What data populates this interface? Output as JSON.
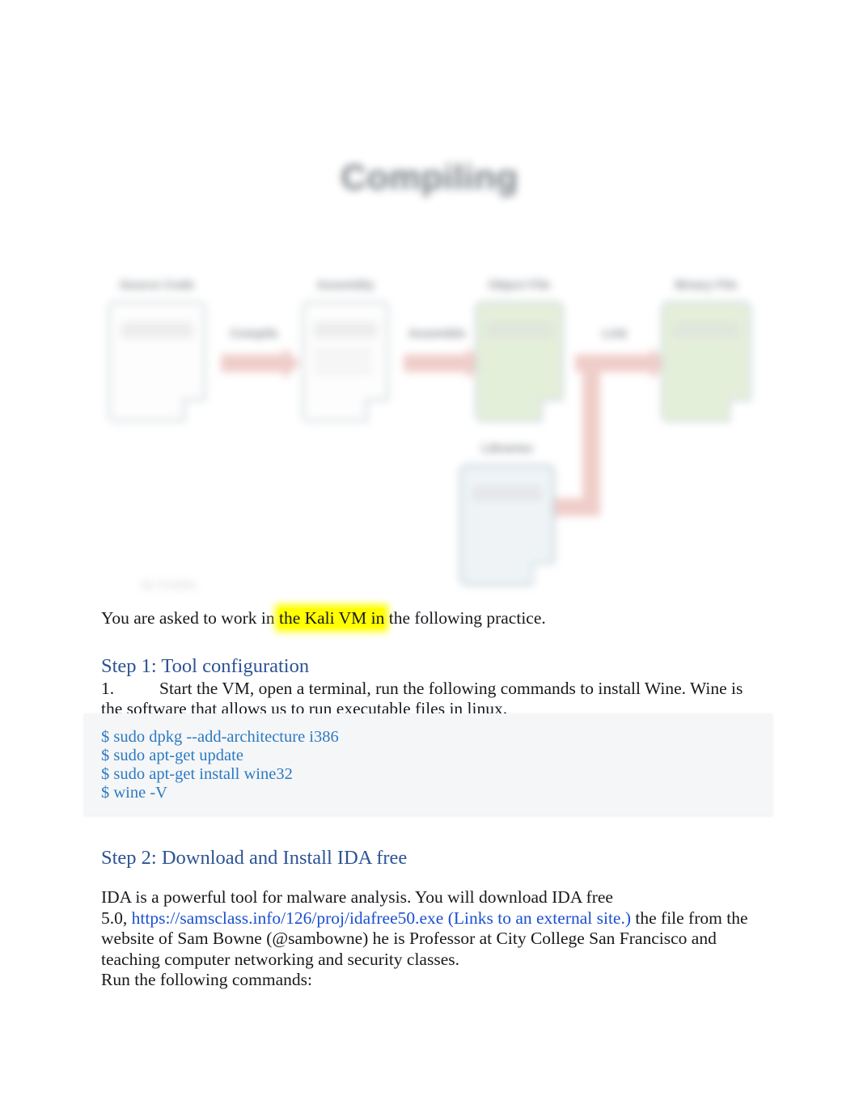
{
  "figure": {
    "title": "Compiling",
    "nodes": [
      {
        "caption": "Source Code",
        "kind": "plain"
      },
      {
        "caption": "Assembly",
        "kind": "plain"
      },
      {
        "caption": "Object File",
        "kind": "green"
      },
      {
        "caption": "Binary File",
        "kind": "green"
      },
      {
        "caption": "Libraries",
        "kind": "blue"
      }
    ],
    "arrows": [
      {
        "label": "Compile"
      },
      {
        "label": "Assemble"
      },
      {
        "label": "Link"
      }
    ],
    "credit": "By Creately",
    "mark": "·"
  },
  "intro": {
    "before": "You are asked to work in ",
    "highlight": "the Kali VM in",
    "after": " the following practice."
  },
  "step1": {
    "heading": "Step 1: Tool configuration",
    "number": "1.",
    "text": "Start the VM, open a terminal, run the following commands to install Wine. Wine is the software that allows us to run executable files in linux.",
    "commands": [
      "$ sudo dpkg --add-architecture i386",
      "$ sudo apt-get update",
      "$ sudo apt-get install wine32",
      "$ wine -V"
    ]
  },
  "step2": {
    "heading": "Step 2: Download and Install IDA free",
    "para_a": "IDA is a powerful tool for malware analysis. You will download IDA free",
    "para_b_prefix": "5.0, ",
    "link_url": "https://samsclass.info/126/proj/idafree50.exe",
    "link_note": " (Links to an external site.)",
    "para_b_suffix": " the file from the website of Sam Bowne (@sambowne) he is Professor at City College San Francisco and teaching computer networking and security classes.",
    "para_c": "Run the following commands:"
  },
  "colors": {
    "heading_blue": "#2d5395",
    "link_blue": "#1a4fd0",
    "code_blue": "#2b7ac2",
    "code_bg": "#f5f6f7",
    "highlight_yellow": "#ffff00"
  }
}
